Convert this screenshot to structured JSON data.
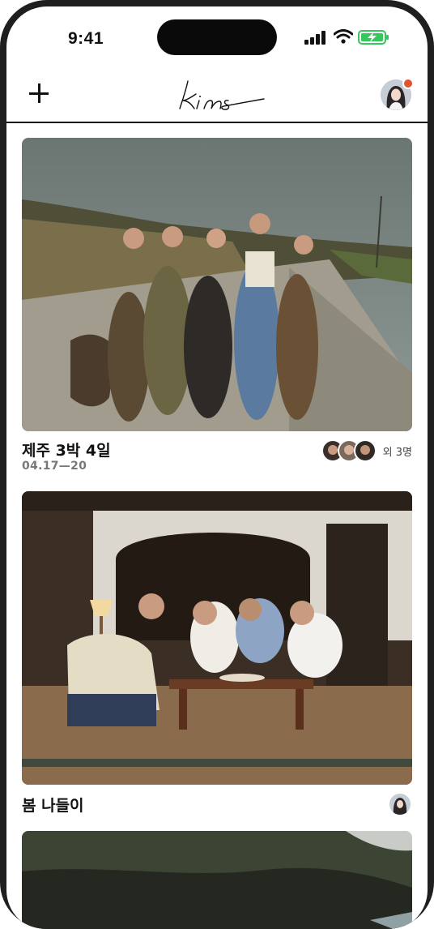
{
  "status_bar": {
    "time": "9:41"
  },
  "header": {
    "logo_text": "kins"
  },
  "feed": [
    {
      "title": "제주 3박 4일",
      "dates": "04.17—20",
      "members_more": "외 3명",
      "photo": "group of five friends standing on a coastal road",
      "avatar_icons": [
        "member-avatar-1",
        "member-avatar-2",
        "member-avatar-3"
      ]
    },
    {
      "title": "봄 나들이",
      "photo": "friends sitting around a low table in a living room",
      "avatar_icons": [
        "member-avatar"
      ]
    },
    {
      "title": "",
      "photo": "silhouettes against a rocky coastline at dusk"
    }
  ],
  "colors": {
    "text": "#111111",
    "muted": "#777777",
    "notification": "#e0542f",
    "battery": "#34c759"
  }
}
